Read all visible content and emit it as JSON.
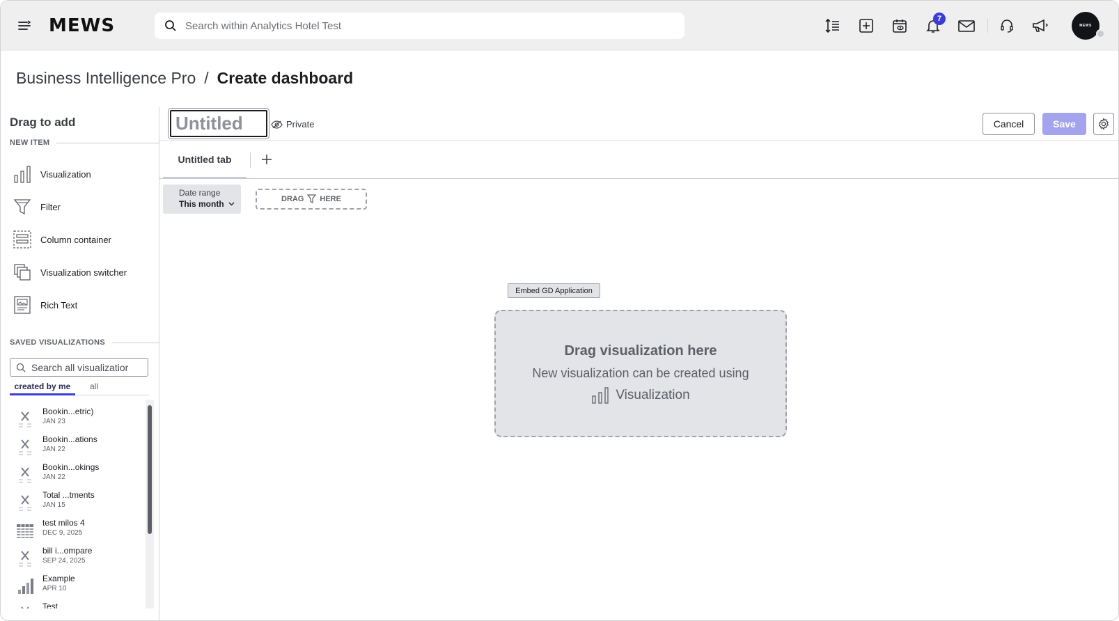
{
  "app": {
    "logo": "MEWS",
    "avatar_text": "MEWS"
  },
  "search": {
    "placeholder": "Search within Analytics Hotel Test"
  },
  "header": {
    "notifications_count": "7"
  },
  "breadcrumb": {
    "parent": "Business Intelligence Pro",
    "separator": "/",
    "current": "Create dashboard"
  },
  "left_panel": {
    "title": "Drag to add",
    "new_item_header": "NEW ITEM",
    "new_items": [
      {
        "label": "Visualization",
        "icon": "bar-chart-icon"
      },
      {
        "label": "Filter",
        "icon": "funnel-icon"
      },
      {
        "label": "Column container",
        "icon": "column-container-icon"
      },
      {
        "label": "Visualization switcher",
        "icon": "stacked-cards-icon"
      },
      {
        "label": "Rich Text",
        "icon": "rich-text-icon"
      }
    ],
    "saved_header": "SAVED VISUALIZATIONS",
    "saved_search_placeholder": "Search all visualizatior",
    "tabs": {
      "active": "created by me",
      "other": "all"
    },
    "saved_items": [
      {
        "name": "Bookin...etric)",
        "date": "JAN 23",
        "icon": "headline-icon"
      },
      {
        "name": "Bookin...ations",
        "date": "JAN 22",
        "icon": "headline-icon"
      },
      {
        "name": "Bookin...okings",
        "date": "JAN 22",
        "icon": "headline-icon"
      },
      {
        "name": "Total ...tments",
        "date": "JAN 15",
        "icon": "headline-icon"
      },
      {
        "name": "test milos 4",
        "date": "DEC 9, 2025",
        "icon": "table-icon"
      },
      {
        "name": "bill i...ompare",
        "date": "SEP 24, 2025",
        "icon": "headline-icon"
      },
      {
        "name": "Example",
        "date": "APR 10",
        "icon": "column-chart-icon"
      },
      {
        "name": "Test",
        "date": "",
        "icon": "headline-icon"
      }
    ]
  },
  "editor": {
    "title_placeholder": "Untitled",
    "privacy": "Private",
    "cancel": "Cancel",
    "save": "Save",
    "tab_name": "Untitled tab",
    "date_filter": {
      "label": "Date range",
      "value": "This month"
    },
    "drag_filter": {
      "left": "DRAG",
      "right": "HERE"
    },
    "tooltip": "Embed GD Application",
    "dropzone": {
      "title": "Drag visualization here",
      "subtitle": "New visualization can be created using",
      "link": "Visualization"
    }
  }
}
